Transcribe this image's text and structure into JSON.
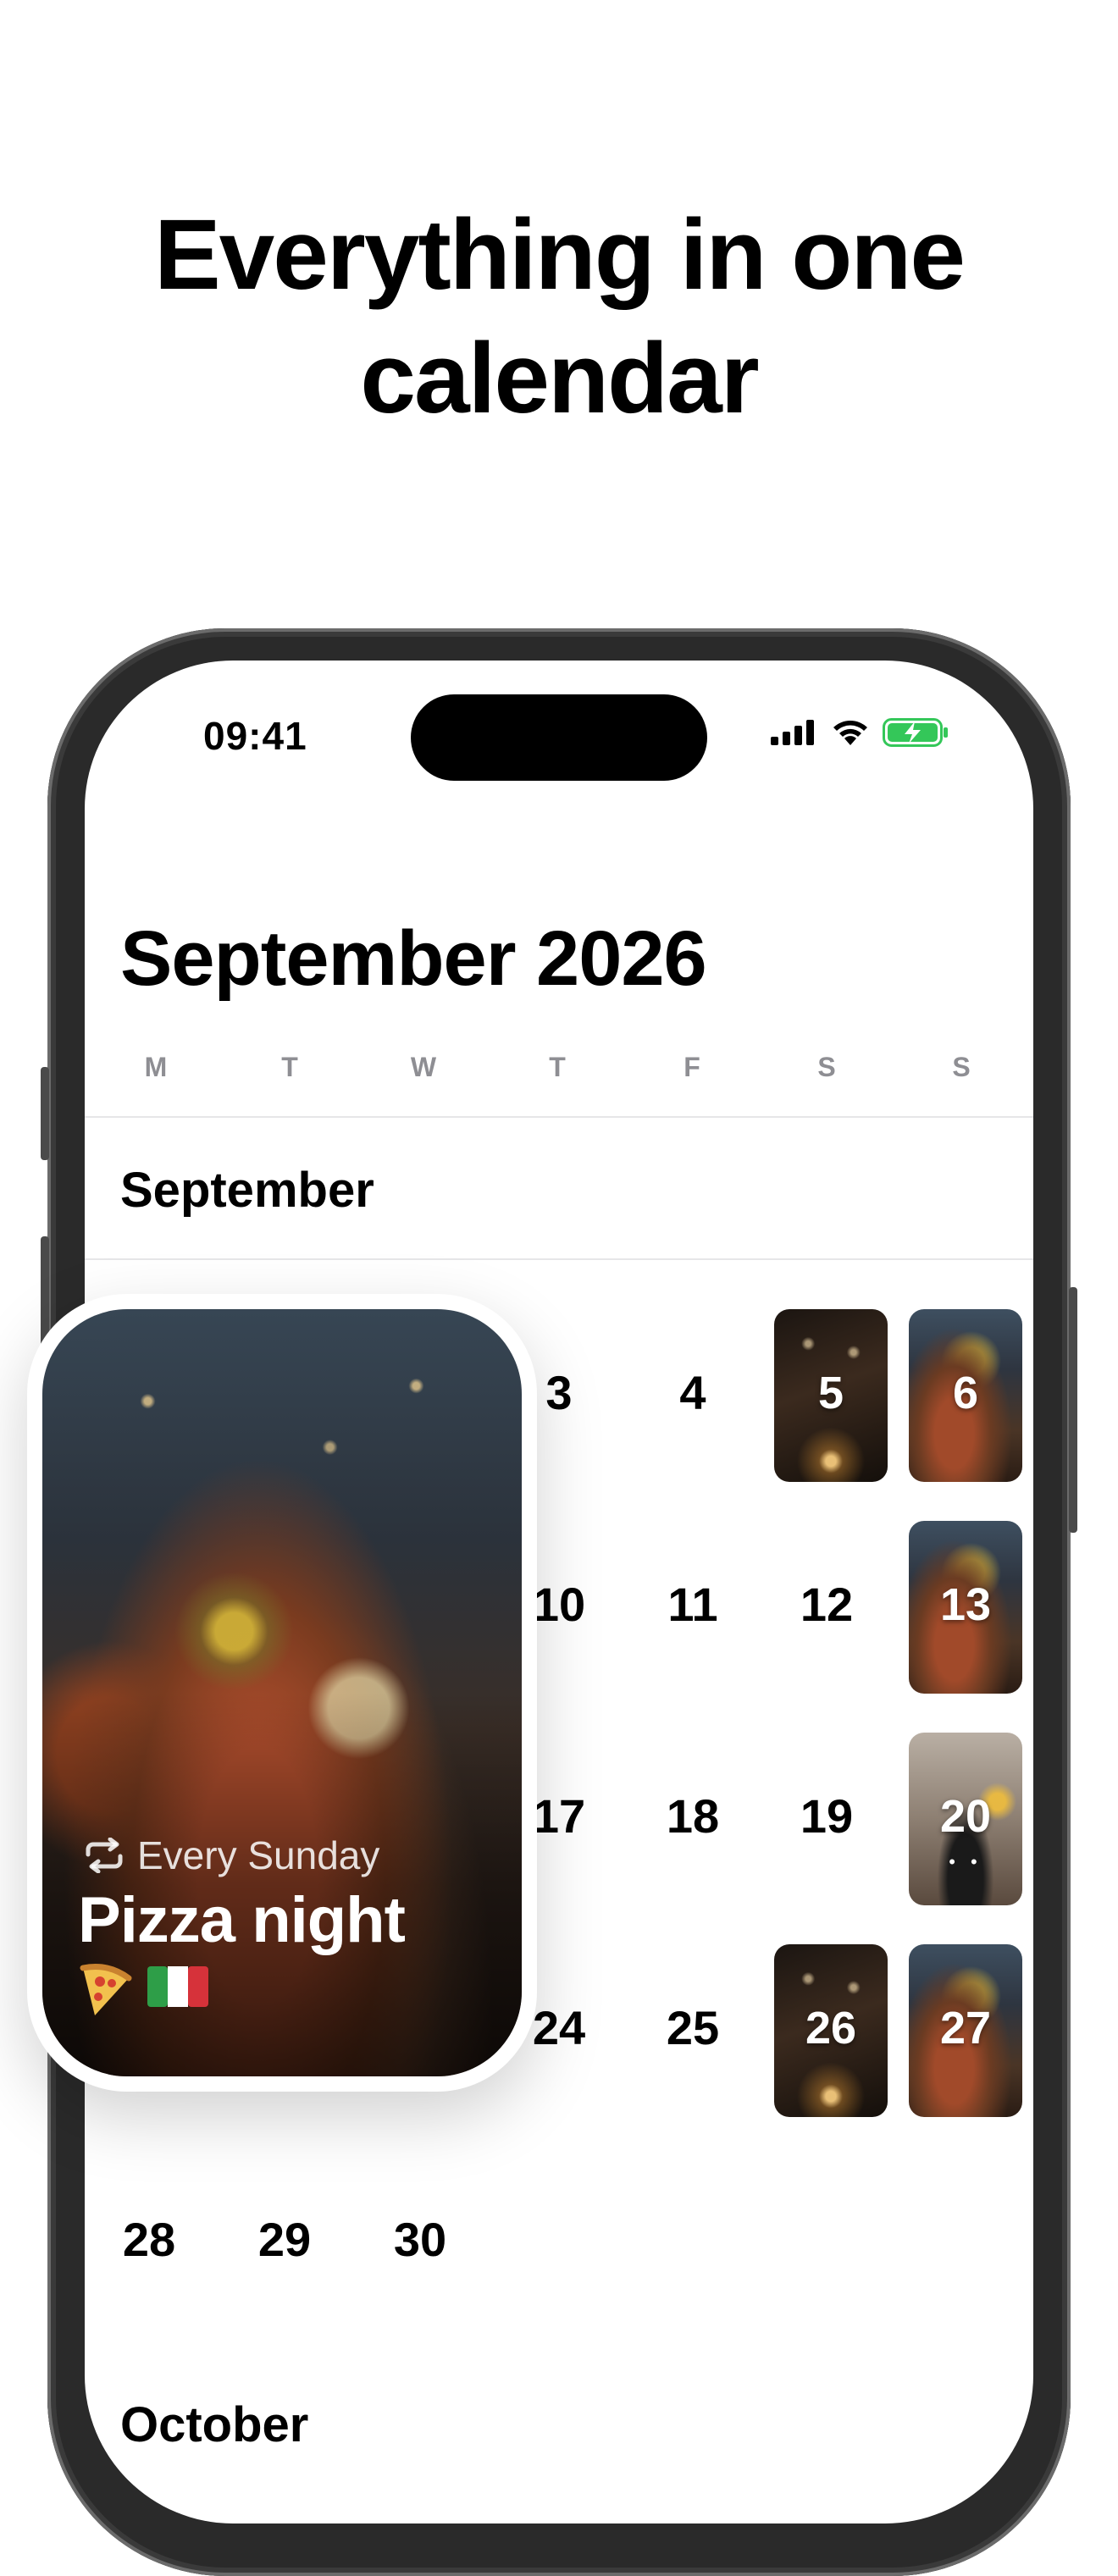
{
  "headline": {
    "line1": "Everything in one",
    "line2": "calendar"
  },
  "status_bar": {
    "time": "09:41"
  },
  "calendar": {
    "title": "September 2026",
    "weekdays": [
      "M",
      "T",
      "W",
      "T",
      "F",
      "S",
      "S"
    ],
    "section_label": "September",
    "next_section_label": "October",
    "days": {
      "d3": "3",
      "d4": "4",
      "d5": "5",
      "d6": "6",
      "d10": "10",
      "d11": "11",
      "d12": "12",
      "d13": "13",
      "d17": "17",
      "d18": "18",
      "d19": "19",
      "d20": "20",
      "d24": "24",
      "d25": "25",
      "d26": "26",
      "d27": "27",
      "d28": "28",
      "d29": "29",
      "d30": "30"
    },
    "day20_indicator": "• •"
  },
  "event_card": {
    "recurrence": "Every Sunday",
    "title": "Pizza night",
    "emoji_icons": [
      "pizza-icon",
      "italy-flag-icon"
    ]
  },
  "colors": {
    "battery_green": "#34c759",
    "weekday_gray": "#8e8e93"
  }
}
